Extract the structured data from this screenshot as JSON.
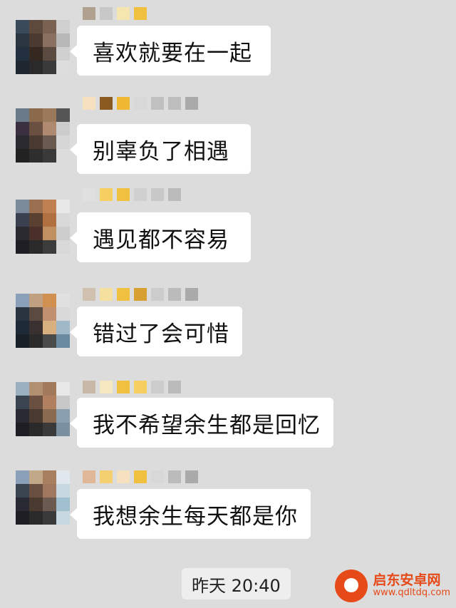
{
  "messages": [
    {
      "text": "喜欢就要在一起"
    },
    {
      "text": "别辜负了相遇"
    },
    {
      "text": "遇见都不容易"
    },
    {
      "text": "错过了会可惜"
    },
    {
      "text": "我不希望余生都是回忆"
    },
    {
      "text": "我想余生每天都是你"
    }
  ],
  "timestamp": "昨天 20:40",
  "watermark": {
    "name": "启东安卓网",
    "url": "www.qdltdq.com"
  },
  "colors": {
    "background": "#dcdcdc",
    "bubble": "#ffffff",
    "watermark": "#e64a19"
  },
  "icons": {
    "avatar": "pixelated-avatar",
    "logo": "watermark-logo"
  }
}
